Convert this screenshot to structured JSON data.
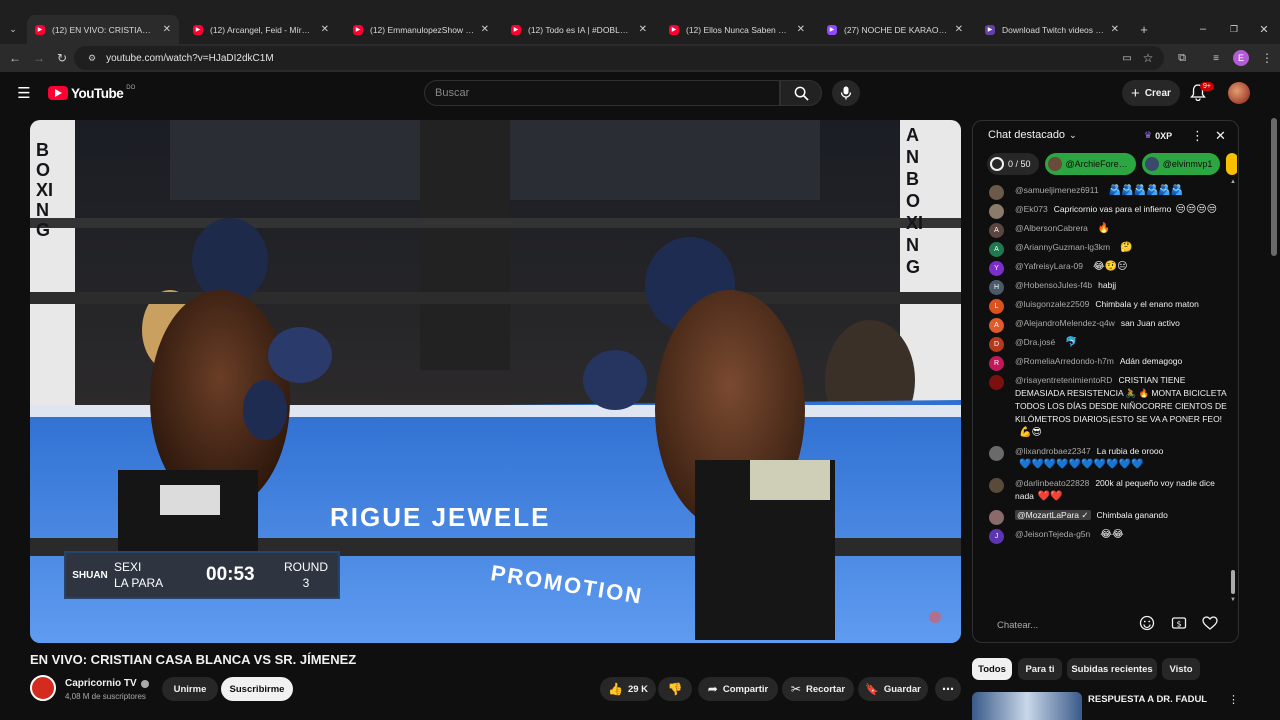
{
  "tabs": [
    {
      "title": "(12) EN VIVO: CRISTIAN CA…",
      "color": "#ff0033",
      "active": true
    },
    {
      "title": "(12) Arcangel, Feid - Mírame Ba…",
      "color": "#ff0033"
    },
    {
      "title": "(12) EmmanulopezShow - YouT…",
      "color": "#ff0033"
    },
    {
      "title": "(12) Todo es IA | #DOBLAO - Yo…",
      "color": "#ff0033"
    },
    {
      "title": "(12) Ellos Nunca Saben Nada | …",
      "color": "#ff0033"
    },
    {
      "title": "(27) NOCHE DE KARAOKE!!!!!! …",
      "color": "#9146ff"
    },
    {
      "title": "Download Twitch videos online…",
      "color": "#6441a5"
    }
  ],
  "url": "youtube.com/watch?v=HJaDI2dkC1M",
  "header": {
    "logo": "YouTube",
    "region": "DO",
    "search_placeholder": "Buscar",
    "create_label": "Crear",
    "notif_count": "9+",
    "profile_initial": "E"
  },
  "video": {
    "scorebug": {
      "brand": "SHUAN",
      "fighter1": "SEXI",
      "fighter2": "LA PARA",
      "time": "00:53",
      "round_label": "ROUND",
      "round": "3"
    },
    "banner_text": "RIGUE JEWELE",
    "promo_text": "PROMOTION",
    "ring_left": "BOXING",
    "ring_right": "AN BOXING"
  },
  "chat": {
    "header": "Chat destacado",
    "xp": "0XP",
    "progress": "0 / 50",
    "pills": [
      "@ArchieFore…",
      "@elvinmvp1"
    ],
    "messages": [
      {
        "author": "@samueljimenez6911",
        "text": "",
        "emoji": "🫂🫂🫂🫂🫂🫂",
        "av": "#6b5a4a",
        "avtxt": ""
      },
      {
        "author": "@Ek073",
        "text": "Capricornio vas para el infierno",
        "emoji": "😒😒😒😒",
        "av": "#8b7b6b",
        "avtxt": ""
      },
      {
        "author": "@AlbersonCabrera",
        "text": "",
        "emoji": "🔥",
        "av": "#5a4540",
        "avtxt": "A"
      },
      {
        "author": "@AriannyGuzman-lg3km",
        "text": "",
        "emoji": "🤔",
        "av": "#1e7a4e",
        "avtxt": "A"
      },
      {
        "author": "@YafreisyLara-09",
        "text": "",
        "emoji": "😂🤨😑",
        "av": "#7b2fc9",
        "avtxt": "Y"
      },
      {
        "author": "@HobensoJules-f4b",
        "text": "habjj",
        "emoji": "",
        "av": "#4a5a6a",
        "avtxt": "H"
      },
      {
        "author": "@luisgonzalez2509",
        "text": "Chimbala y el enano maton",
        "emoji": "",
        "av": "#d9531e",
        "avtxt": "L"
      },
      {
        "author": "@AlejandroMelendez-q4w",
        "text": "san Juan activo",
        "emoji": "",
        "av": "#e05a2b",
        "avtxt": "A"
      },
      {
        "author": "@Dra.josé",
        "text": "",
        "emoji": "🐬",
        "av": "#b23a1e",
        "avtxt": "D"
      },
      {
        "author": "@RomeliaArredondo-h7m",
        "text": "Adán demagogo",
        "emoji": "",
        "av": "#c2185b",
        "avtxt": "R"
      },
      {
        "author": "@risayentretenimientoRD",
        "text": "CRISTIAN TIENE DEMASIADA RESISTENCIA 🚴 🔥 MONTA BICICLETA TODOS LOS DÍAS DESDE NIÑOCORRE CIENTOS DE KILÓMETROS DIARIOS¡ESTO SE VA A PONER FEO!",
        "emoji": "💪😎",
        "av": "#7a1010",
        "avtxt": ""
      },
      {
        "author": "@lixandrobaez2347",
        "text": "La rubia de orooo",
        "emoji": "💙💙💙💙💙💙💙💙💙💙",
        "av": "#6a6a6a",
        "avtxt": ""
      },
      {
        "author": "@darlinbeato22828",
        "text": "200k al pequeño voy nadie dice nada",
        "emoji": "❤️❤️",
        "av": "#5a4a3a",
        "avtxt": ""
      },
      {
        "author": "@MozartLaPara ✓",
        "text": "Chimbala ganando",
        "emoji": "",
        "av": "#8a6a6a",
        "avtxt": "",
        "highlight": true
      },
      {
        "author": "@JeisonTejeda-g5n",
        "text": "",
        "emoji": "😂😂",
        "av": "#5e35b1",
        "avtxt": "J"
      }
    ],
    "input_placeholder": "Chatear..."
  },
  "below": {
    "title": "EN VIVO: CRISTIAN CASA BLANCA VS SR. JÍMENEZ",
    "channel": "Capricornio TV",
    "subs": "4,08 M de suscriptores",
    "join": "Unirme",
    "subscribe": "Suscribirme",
    "likes": "29 K",
    "share": "Compartir",
    "clip": "Recortar",
    "save": "Guardar"
  },
  "filters": [
    "Todos",
    "Para ti",
    "Subidas recientes",
    "Visto"
  ],
  "rec_title": "RESPUESTA A DR. FADUL"
}
